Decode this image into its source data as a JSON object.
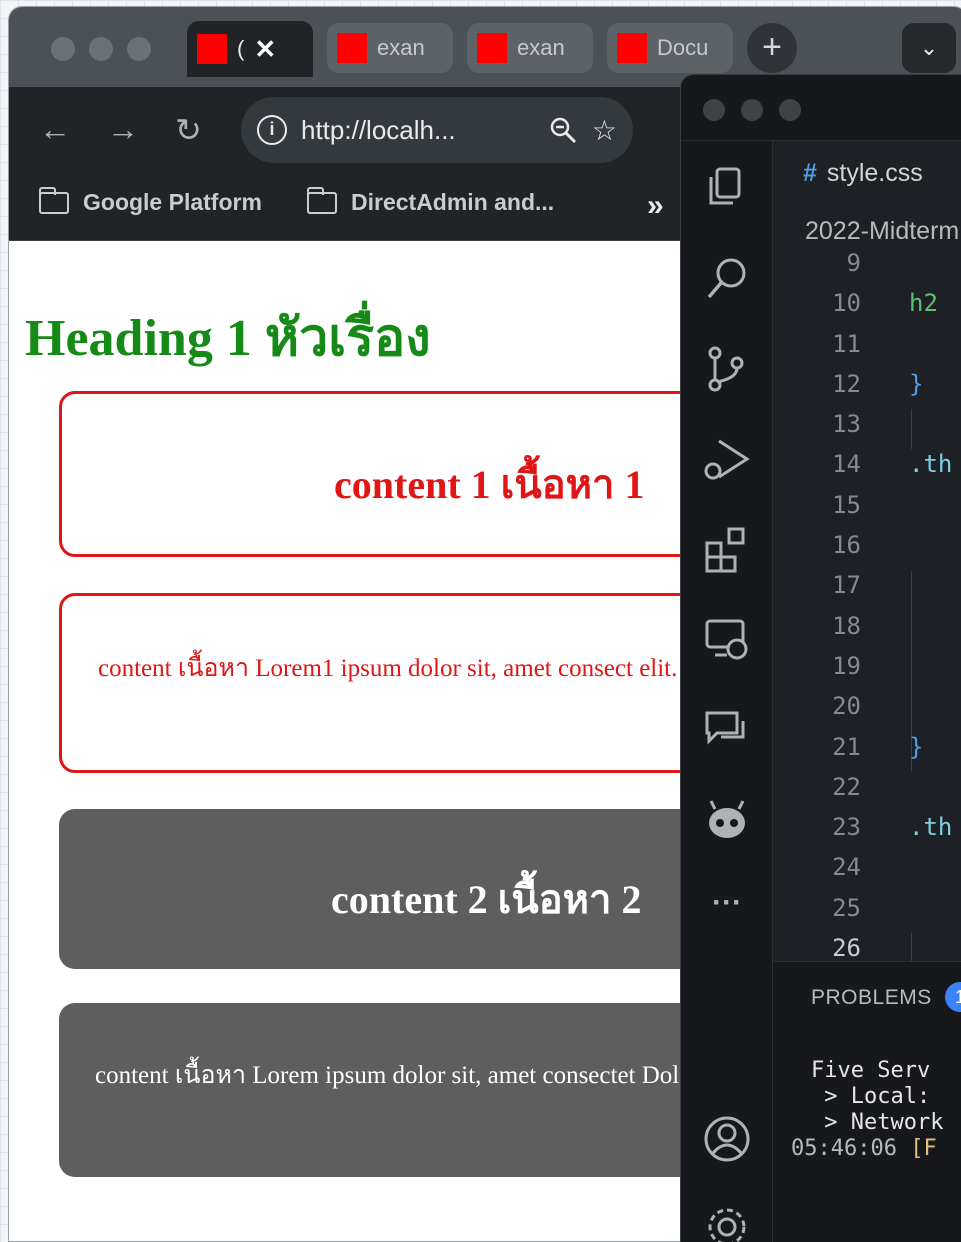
{
  "browser": {
    "tabs": [
      {
        "label": "(",
        "active": true
      },
      {
        "label": "exan",
        "active": false
      },
      {
        "label": "exan",
        "active": false
      },
      {
        "label": "Docu",
        "active": false
      }
    ],
    "close_glyph": "✕",
    "new_tab_glyph": "+",
    "tab_search_glyph": "⌄",
    "url": "http://localh...",
    "bookmarks": [
      "Google Platform",
      "DirectAdmin and..."
    ],
    "bookmarks_overflow": "»"
  },
  "page": {
    "heading": "Heading 1 หัวเรื่อง",
    "box1_title": "content 1 เนื้อหา 1",
    "box1_text": "content เนื้อหา Lorem1 ipsum dolor sit, amet consect elit. Dolorum, facere.",
    "box2_title": "content 2 เนื้อหา 2",
    "box2_text": "content เนื้อหา Lorem ipsum dolor sit, amet consectet Dolorum, facere."
  },
  "colors": {
    "heading": "#168a16",
    "outline_box": "#e01515",
    "dark_box": "#5e5e5e",
    "favicon": "#ff0000"
  },
  "vscode": {
    "file_tab": "style.css",
    "file_tab_icon": "#",
    "breadcrumb": "2022-Midterm",
    "line_numbers": [
      "9",
      "10",
      "11",
      "12",
      "13",
      "14",
      "15",
      "16",
      "17",
      "18",
      "19",
      "20",
      "21",
      "22",
      "23",
      "24",
      "25",
      "26"
    ],
    "code": {
      "line10": "h2",
      "line12": "}",
      "line14": ".th",
      "line21": "}",
      "line23": ".th"
    },
    "activity_icons": [
      "explorer-icon",
      "search-icon",
      "source-control-icon",
      "run-debug-icon",
      "extensions-icon",
      "remote-explorer-icon",
      "chat-icon",
      "copilot-icon",
      "more-icon",
      "account-icon",
      "settings-icon"
    ],
    "more_glyph": "···",
    "panel_tab": "PROBLEMS",
    "panel_badge": "1",
    "terminal": {
      "line1": "Five Serv",
      "line2": " > Local:",
      "line3": " > Network",
      "line4_time": "05:46:06",
      "line4_tag": " [F"
    }
  }
}
